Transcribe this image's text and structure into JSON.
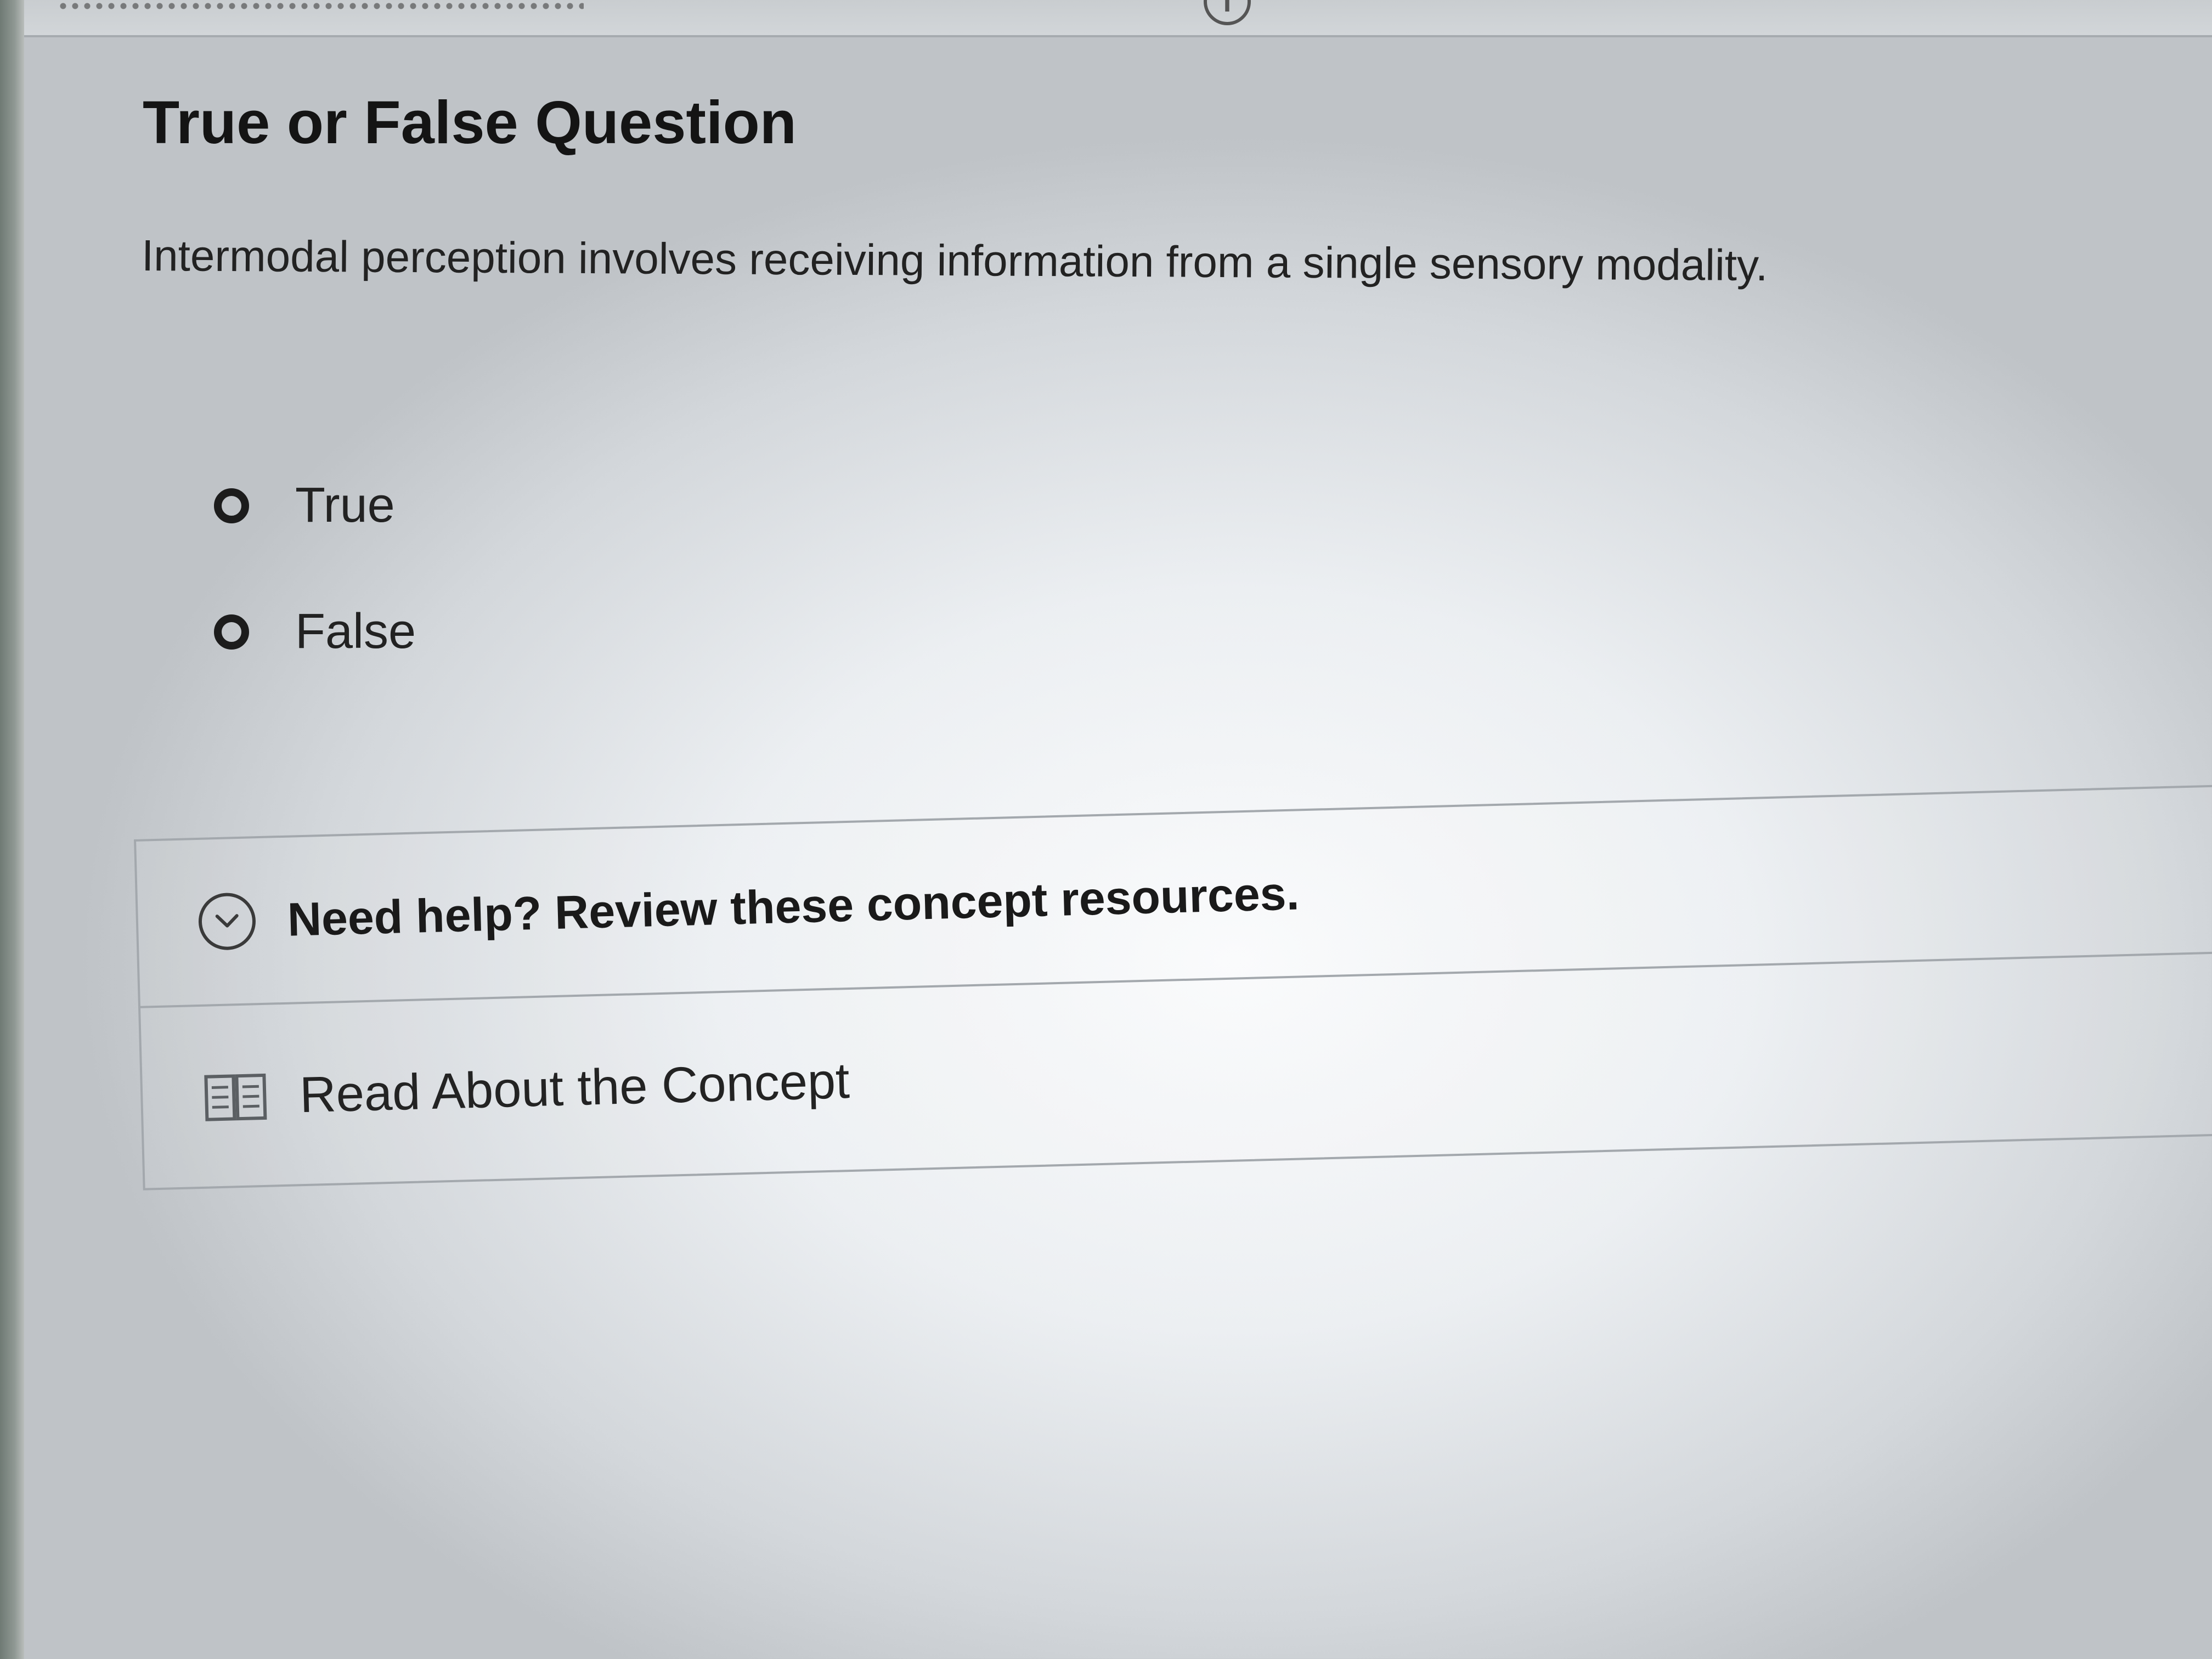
{
  "question": {
    "title": "True or False Question",
    "prompt": "Intermodal perception involves receiving information from a single sensory modality.",
    "options": [
      {
        "label": "True",
        "selected": false
      },
      {
        "label": "False",
        "selected": false
      }
    ]
  },
  "help": {
    "header_label": "Need help? Review these concept resources.",
    "header_icon": "chevron-down-circle-icon",
    "resources": [
      {
        "label": "Read About the Concept",
        "icon": "book-icon"
      }
    ]
  },
  "colors": {
    "text": "#1c1c1c",
    "border": "#a3a8ad",
    "background": "#eceff2"
  }
}
